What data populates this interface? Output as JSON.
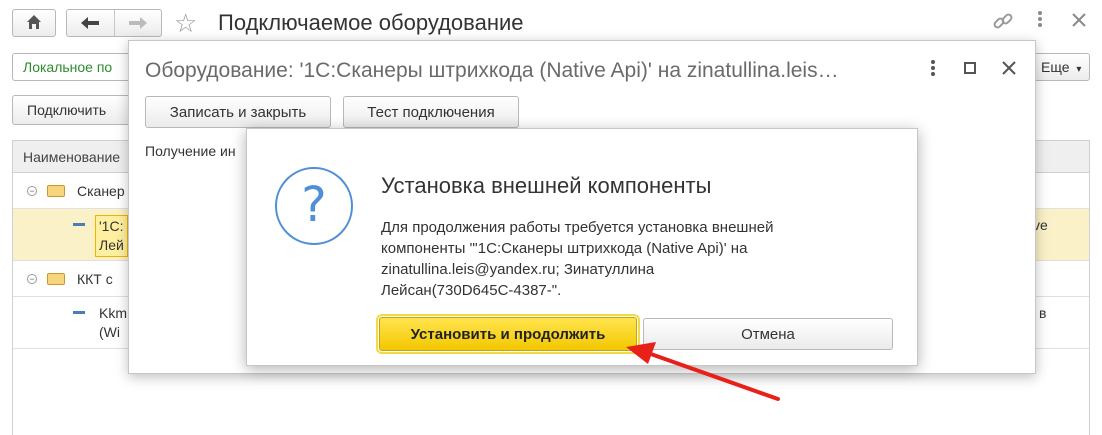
{
  "main": {
    "title": "Подключаемое оборудование",
    "local_tab": "Локальное по",
    "more_label": "Еще",
    "connect_label": "Подключить",
    "table": {
      "header": "Наименование",
      "rows": [
        {
          "label": "Сканер",
          "type": "group"
        },
        {
          "label1": "'1С:",
          "label2": "Лей",
          "right": "ve",
          "type": "item",
          "selected": true
        },
        {
          "label": "ККТ с",
          "type": "group"
        },
        {
          "label1": "Kkm",
          "label2": "(Wi",
          "right": "в",
          "type": "item"
        }
      ]
    }
  },
  "equipment_dialog": {
    "title": "Оборудование: '1С:Сканеры штрихкода (Native Api)' на zinatullina.leis…",
    "save_close": "Записать и закрыть",
    "test_connection": "Тест подключения",
    "partial_label": "Получение ин"
  },
  "install_dialog": {
    "title": "Установка внешней компоненты",
    "line1": "Для продолжения работы требуется установка внешней",
    "line2": "компоненты \"'1С:Сканеры штрихкода (Native Api)' на",
    "line3": "zinatullina.leis@yandex.ru; Зинатуллина",
    "line4": "Лейсан(730D645C-4387-\".",
    "install_button": "Установить и продолжить",
    "cancel_button": "Отмена"
  },
  "colors": {
    "accent_yellow": "#f3c700",
    "question_blue": "#4f8fd6",
    "arrow_red": "#e8201a",
    "selected_row": "#fbf1c8"
  }
}
